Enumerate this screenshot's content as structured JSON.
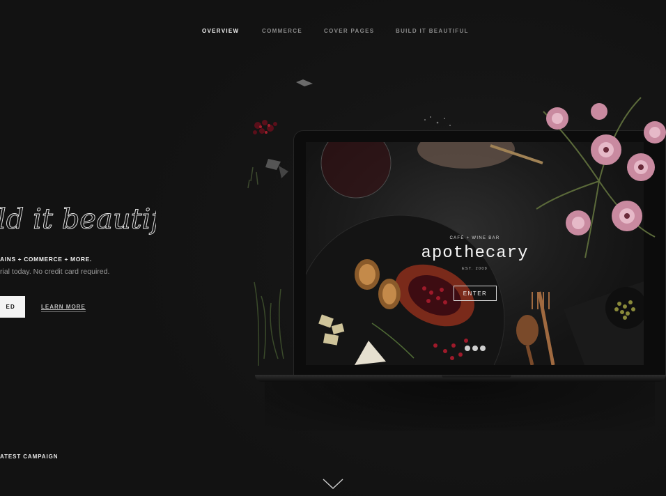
{
  "nav": {
    "items": [
      {
        "label": "OVERVIEW",
        "active": true
      },
      {
        "label": "COMMERCE",
        "active": false
      },
      {
        "label": "COVER PAGES",
        "active": false
      },
      {
        "label": "BUILD IT BEAUTIFUL",
        "active": false
      }
    ]
  },
  "hero": {
    "script_text": "ld it beautiful",
    "tagline": "AINS + COMMERCE + MORE.",
    "subline": "rial today. No credit card required.",
    "cta_label": "ED",
    "learn_more_label": "LEARN MORE"
  },
  "screen": {
    "pretitle": "CAFÉ + WINE BAR",
    "title": "apothecary",
    "established": "EST. 2009",
    "enter_label": "ENTER",
    "social_icons": [
      "twitter-icon",
      "facebook-icon",
      "instagram-icon"
    ]
  },
  "footer": {
    "campaign_label": "ATEST CAMPAIGN"
  },
  "colors": {
    "background": "#131313",
    "nav_active": "#f2f2f2",
    "nav_inactive": "#8a8a8a",
    "cta_background": "#f4f4f4"
  }
}
